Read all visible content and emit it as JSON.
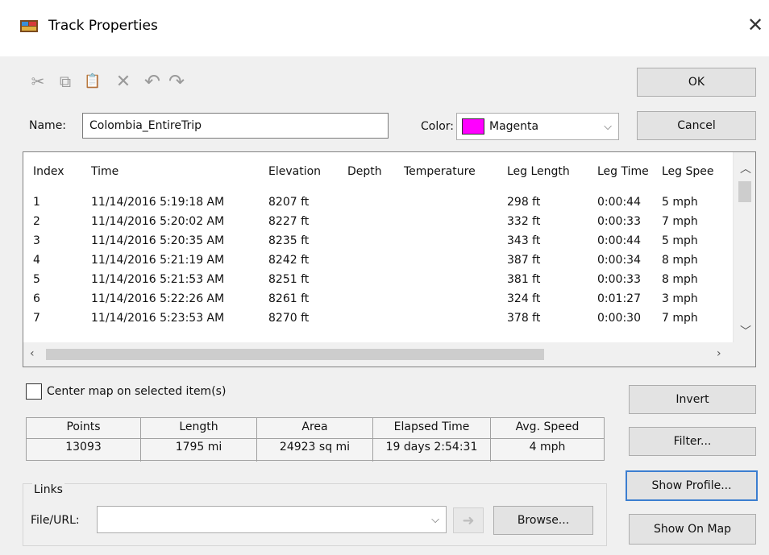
{
  "window": {
    "title": "Track Properties",
    "icon": "track-properties-icon",
    "close_glyph": "✕"
  },
  "toolbar": {
    "icons": [
      {
        "name": "cut-icon",
        "glyph": "✂"
      },
      {
        "name": "copy-icon",
        "glyph": "⧉"
      },
      {
        "name": "paste-icon",
        "glyph": "📋"
      },
      {
        "name": "delete-icon",
        "glyph": "✕"
      },
      {
        "name": "undo-icon",
        "glyph": "↶"
      },
      {
        "name": "redo-icon",
        "glyph": "↷"
      }
    ]
  },
  "form": {
    "name_label": "Name:",
    "name_value": "Colombia_EntireTrip",
    "color_label": "Color:",
    "color_value": "Magenta",
    "color_hex": "#ff00ff"
  },
  "buttons": {
    "ok": "OK",
    "cancel": "Cancel",
    "invert": "Invert",
    "filter": "Filter...",
    "show_profile": "Show Profile...",
    "show_on_map": "Show On Map",
    "browse": "Browse..."
  },
  "table": {
    "columns": [
      "Index",
      "Time",
      "Elevation",
      "Depth",
      "Temperature",
      "Leg Length",
      "Leg Time",
      "Leg Spee"
    ],
    "rows": [
      [
        "1",
        "11/14/2016 5:19:18 AM",
        "8207 ft",
        "",
        "",
        "298 ft",
        "0:00:44",
        "5 mph"
      ],
      [
        "2",
        "11/14/2016 5:20:02 AM",
        "8227 ft",
        "",
        "",
        "332 ft",
        "0:00:33",
        "7 mph"
      ],
      [
        "3",
        "11/14/2016 5:20:35 AM",
        "8235 ft",
        "",
        "",
        "343 ft",
        "0:00:44",
        "5 mph"
      ],
      [
        "4",
        "11/14/2016 5:21:19 AM",
        "8242 ft",
        "",
        "",
        "387 ft",
        "0:00:34",
        "8 mph"
      ],
      [
        "5",
        "11/14/2016 5:21:53 AM",
        "8251 ft",
        "",
        "",
        "381 ft",
        "0:00:33",
        "8 mph"
      ],
      [
        "6",
        "11/14/2016 5:22:26 AM",
        "8261 ft",
        "",
        "",
        "324 ft",
        "0:01:27",
        "3 mph"
      ],
      [
        "7",
        "11/14/2016 5:23:53 AM",
        "8270 ft",
        "",
        "",
        "378 ft",
        "0:00:30",
        "7 mph"
      ]
    ]
  },
  "center_map": {
    "label": "Center map on selected item(s)",
    "checked": false
  },
  "stats": [
    {
      "label": "Points",
      "value": "13093"
    },
    {
      "label": "Length",
      "value": "1795 mi"
    },
    {
      "label": "Area",
      "value": "24923 sq mi"
    },
    {
      "label": "Elapsed Time",
      "value": "19 days 2:54:31"
    },
    {
      "label": "Avg. Speed",
      "value": "4 mph"
    }
  ],
  "links": {
    "group_label": "Links",
    "file_url_label": "File/URL:",
    "file_url_value": ""
  }
}
